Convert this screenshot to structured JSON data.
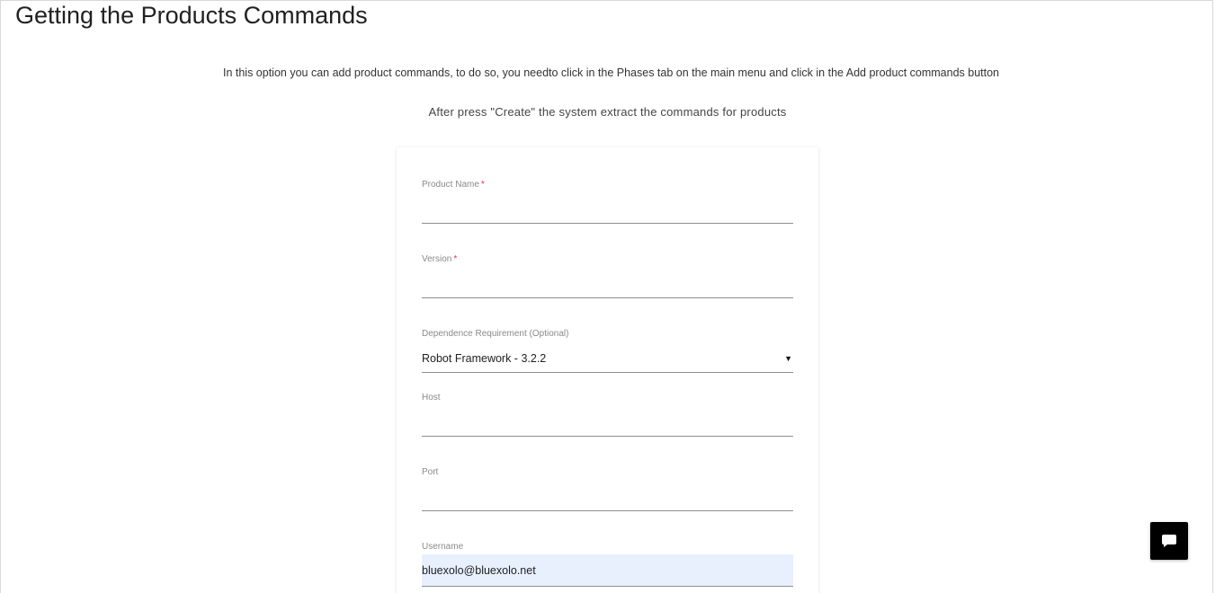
{
  "page": {
    "title": "Getting the Products Commands",
    "intro": "In this option you can add product commands, to do so, you needto click in the Phases tab on the main menu and click in the Add product commands button",
    "subintro": "After press \"Create\" the system extract the commands for products"
  },
  "form": {
    "product_name": {
      "label": "Product Name",
      "required_mark": "*",
      "value": ""
    },
    "version": {
      "label": "Version",
      "required_mark": "*",
      "value": ""
    },
    "dependence": {
      "label": "Dependence Requirement (Optional)",
      "selected": "Robot Framework - 3.2.2",
      "caret": "▼"
    },
    "host": {
      "label": "Host",
      "value": ""
    },
    "port": {
      "label": "Port",
      "value": ""
    },
    "username": {
      "label": "Username",
      "value": "bluexolo@bluexolo.net"
    }
  },
  "chat_widget": {
    "icon": "chat-bubble-icon",
    "bg_color": "#000000"
  }
}
